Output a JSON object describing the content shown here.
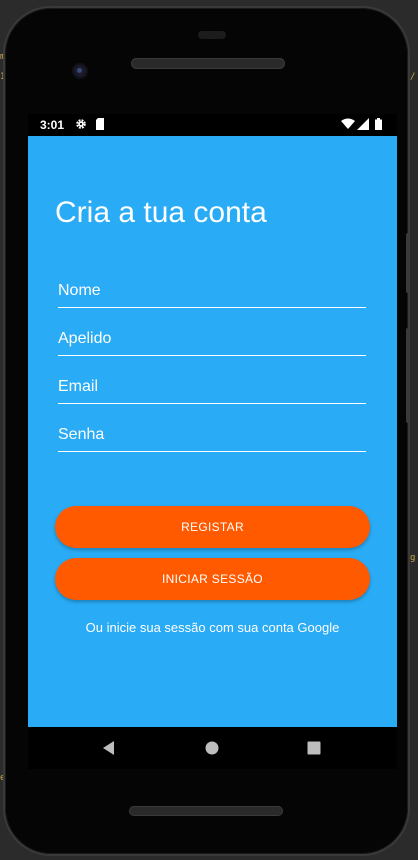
{
  "status_bar": {
    "time": "3:01",
    "icons": [
      "gear-icon",
      "sd-card-icon",
      "wifi-icon",
      "signal-icon",
      "battery-icon"
    ]
  },
  "signup": {
    "title": "Cria a tua conta",
    "fields": {
      "name_placeholder": "Nome",
      "surname_placeholder": "Apelido",
      "email_placeholder": "Email",
      "password_placeholder": "Senha"
    },
    "register_button": "REGISTAR",
    "login_button": "INICIAR SESSÃO",
    "google_text": "Ou inicie sua sessão com sua conta Google"
  },
  "nav_bar": {
    "icons": [
      "back-icon",
      "home-icon",
      "recents-icon"
    ]
  },
  "colors": {
    "background": "#29abf5",
    "button": "#ff5a00",
    "text": "#ffffff"
  }
}
